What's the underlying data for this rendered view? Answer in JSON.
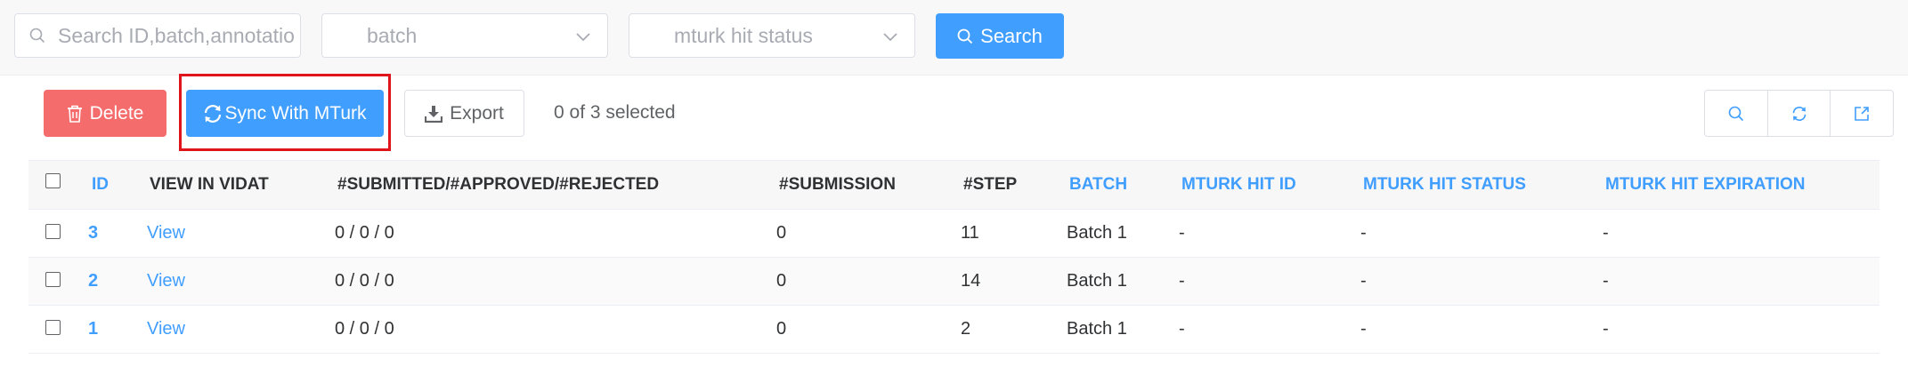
{
  "filters": {
    "search_placeholder": "Search ID,batch,annotatio",
    "batch_placeholder": "batch",
    "status_placeholder": "mturk hit status",
    "search_button": "Search"
  },
  "toolbar": {
    "delete_label": "Delete",
    "sync_label": "Sync With MTurk",
    "export_label": "Export",
    "selected_text": "0 of 3 selected"
  },
  "colors": {
    "primary": "#409eff",
    "danger": "#f56c6c",
    "highlight_box": "#e0141b"
  },
  "icons": [
    "search-icon",
    "chevron-down-icon",
    "trash-icon",
    "sync-icon",
    "download-icon",
    "refresh-icon",
    "export-icon"
  ],
  "table": {
    "columns": [
      "ID",
      "VIEW IN VIDAT",
      "#SUBMITTED/#APPROVED/#REJECTED",
      "#SUBMISSION",
      "#STEP",
      "BATCH",
      "MTURK HIT ID",
      "MTURK HIT STATUS",
      "MTURK HIT EXPIRATION"
    ],
    "rows": [
      {
        "id": "3",
        "view": "View",
        "counts": "0 / 0 / 0",
        "submission": "0",
        "step": "11",
        "batch": "Batch 1",
        "hit_id": "-",
        "hit_status": "-",
        "hit_expiration": "-"
      },
      {
        "id": "2",
        "view": "View",
        "counts": "0 / 0 / 0",
        "submission": "0",
        "step": "14",
        "batch": "Batch 1",
        "hit_id": "-",
        "hit_status": "-",
        "hit_expiration": "-"
      },
      {
        "id": "1",
        "view": "View",
        "counts": "0 / 0 / 0",
        "submission": "0",
        "step": "2",
        "batch": "Batch 1",
        "hit_id": "-",
        "hit_status": "-",
        "hit_expiration": "-"
      }
    ]
  }
}
